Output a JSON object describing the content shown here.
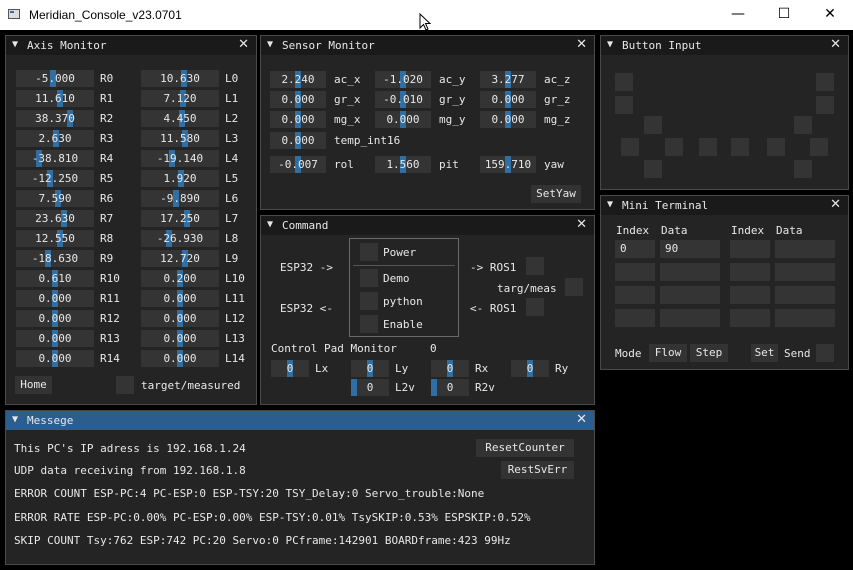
{
  "window": {
    "title": "Meridian_Console_v23.0701",
    "min": "—",
    "max": "☐",
    "close": "✕"
  },
  "axis": {
    "title": "Axis Monitor",
    "rows": [
      {
        "rv": "-5.000",
        "rl": "R0",
        "lv": "10.630",
        "ll": "L0"
      },
      {
        "rv": "11.610",
        "rl": "R1",
        "lv": "7.120",
        "ll": "L1"
      },
      {
        "rv": "38.370",
        "rl": "R2",
        "lv": "4.450",
        "ll": "L2"
      },
      {
        "rv": "2.630",
        "rl": "R3",
        "lv": "11.580",
        "ll": "L3"
      },
      {
        "rv": "-38.810",
        "rl": "R4",
        "lv": "-19.140",
        "ll": "L4"
      },
      {
        "rv": "-12.250",
        "rl": "R5",
        "lv": "1.920",
        "ll": "L5"
      },
      {
        "rv": "7.590",
        "rl": "R6",
        "lv": "-9.890",
        "ll": "L6"
      },
      {
        "rv": "23.630",
        "rl": "R7",
        "lv": "17.250",
        "ll": "L7"
      },
      {
        "rv": "12.550",
        "rl": "R8",
        "lv": "-26.930",
        "ll": "L8"
      },
      {
        "rv": "-18.630",
        "rl": "R9",
        "lv": "12.720",
        "ll": "L9"
      },
      {
        "rv": "0.610",
        "rl": "R10",
        "lv": "0.200",
        "ll": "L10"
      },
      {
        "rv": "0.000",
        "rl": "R11",
        "lv": "0.000",
        "ll": "L11"
      },
      {
        "rv": "0.000",
        "rl": "R12",
        "lv": "0.000",
        "ll": "L12"
      },
      {
        "rv": "0.000",
        "rl": "R13",
        "lv": "0.000",
        "ll": "L13"
      },
      {
        "rv": "0.000",
        "rl": "R14",
        "lv": "0.000",
        "ll": "L14"
      }
    ],
    "home": "Home",
    "target_label": "target/measured"
  },
  "sensor": {
    "title": "Sensor Monitor",
    "rows": [
      [
        {
          "v": "2.240",
          "l": "ac_x"
        },
        {
          "v": "-1.020",
          "l": "ac_y"
        },
        {
          "v": "3.277",
          "l": "ac_z"
        }
      ],
      [
        {
          "v": "0.000",
          "l": "gr_x"
        },
        {
          "v": "-0.010",
          "l": "gr_y"
        },
        {
          "v": "0.000",
          "l": "gr_z"
        }
      ],
      [
        {
          "v": "0.000",
          "l": "mg_x"
        },
        {
          "v": "0.000",
          "l": "mg_y"
        },
        {
          "v": "0.000",
          "l": "mg_z"
        }
      ]
    ],
    "temp": {
      "v": "0.000",
      "l": "temp_int16"
    },
    "rpy": [
      {
        "v": "-0.007",
        "l": "rol"
      },
      {
        "v": "1.560",
        "l": "pit"
      },
      {
        "v": "159.710",
        "l": "yaw"
      }
    ],
    "setyaw": "SetYaw"
  },
  "button": {
    "title": "Button Input"
  },
  "terminal": {
    "title": "Mini Terminal",
    "h_index1": "Index",
    "h_data1": "Data",
    "h_index2": "Index",
    "h_data2": "Data",
    "index0": "0",
    "data0": "90",
    "mode": "Mode",
    "flow": "Flow",
    "step": "Step",
    "set": "Set",
    "send": "Send"
  },
  "command": {
    "title": "Command",
    "esp_out": "ESP32 ->",
    "esp_in": "ESP32 <-",
    "power": "Power",
    "demo": "Demo",
    "python": "python",
    "enable": "Enable",
    "ros_out": "-> ROS1",
    "targ": "targ/meas",
    "ros_in": "<- ROS1",
    "cpm": "Control Pad Monitor",
    "cpm_val": "0",
    "pads": [
      {
        "v": "0",
        "l": "Lx"
      },
      {
        "v": "0",
        "l": "Ly"
      },
      {
        "v": "0",
        "l": "Rx"
      },
      {
        "v": "0",
        "l": "Ry"
      },
      {
        "v": "0",
        "l": "L2v"
      },
      {
        "v": "0",
        "l": "R2v"
      }
    ]
  },
  "message": {
    "title": "Messege",
    "line1": "This PC's IP adress is 192.168.1.24",
    "line2": "UDP data receiving from 192.168.1.8",
    "line3": "ERROR COUNT ESP-PC:4 PC-ESP:0 ESP-TSY:20 TSY_Delay:0    Servo_trouble:None",
    "line4": "ERROR RATE ESP-PC:0.00% PC-ESP:0.00% ESP-TSY:0.01% TsySKIP:0.53% ESPSKIP:0.52%",
    "line5": "SKIP COUNT Tsy:762 ESP:742 PC:20 Servo:0 PCframe:142901 BOARDframe:423 99Hz",
    "reset": "ResetCounter",
    "restsv": "RestSvErr"
  },
  "icons": {
    "collapse": "triangle-down-icon",
    "close": "close-icon"
  }
}
